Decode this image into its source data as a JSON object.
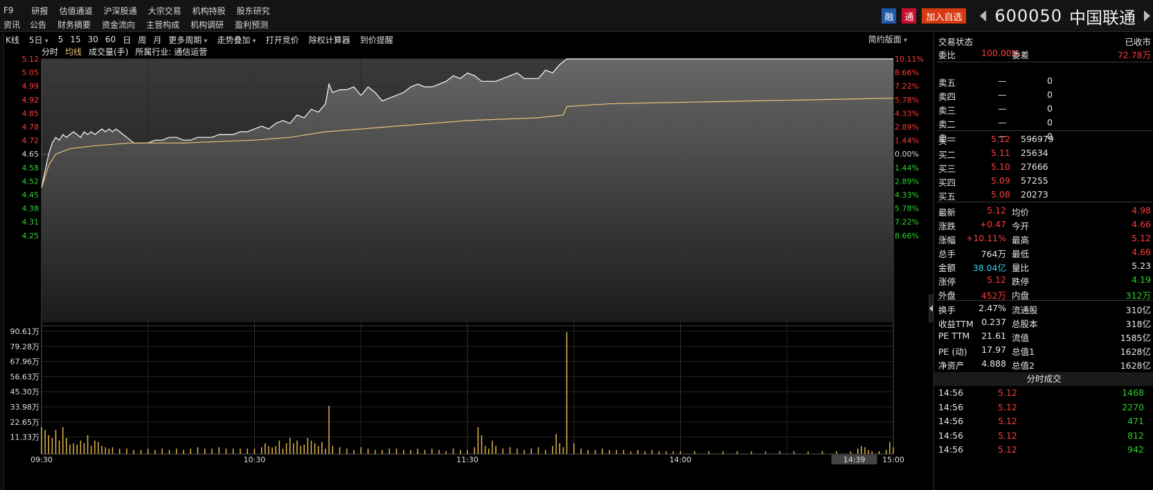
{
  "header": {
    "menu_row1": [
      "F9",
      "研报",
      "估值通道",
      "沪深股通",
      "大宗交易",
      "机构持股",
      "股东研究"
    ],
    "menu_row2": [
      "资讯",
      "公告",
      "财务摘要",
      "资金流向",
      "主营构成",
      "机构调研",
      "盈利预测"
    ],
    "badge_rong": "融",
    "badge_tong": "通",
    "add_watch": "加入自选",
    "stock_code": "600050",
    "stock_name": "中国联通"
  },
  "toolbar": {
    "items": [
      "K线",
      "5日",
      "5",
      "15",
      "30",
      "60",
      "日",
      "周",
      "月",
      "更多周期",
      "走势叠加",
      "打开竞价",
      "除权计算器",
      "到价提醒"
    ],
    "layout": "简约版面"
  },
  "subbar": {
    "fenshi": "分时",
    "junxian": "均线",
    "volume": "成交量(手)",
    "industry": "所属行业: 通信运营"
  },
  "colors": {
    "up": "#ff3b3b",
    "down": "#2bd42b",
    "price_line": "#ffffff",
    "avg_line": "#e8c27a",
    "volume_bar": "#e8b84a"
  },
  "chart_data": {
    "type": "line",
    "price_axis": [
      "5.12",
      "5.05",
      "4.99",
      "4.92",
      "4.85",
      "4.78",
      "4.72",
      "4.65",
      "4.58",
      "4.52",
      "4.45",
      "4.38",
      "4.31",
      "4.25"
    ],
    "pct_axis": [
      "10.11%",
      "8.66%",
      "7.22%",
      "5.78%",
      "4.33%",
      "2.89%",
      "1.44%",
      "0.00%",
      "1.44%",
      "2.89%",
      "4.33%",
      "5.78%",
      "7.22%",
      "8.66%"
    ],
    "volume_axis": [
      "90.61万",
      "79.28万",
      "67.96万",
      "56.63万",
      "45.30万",
      "33.98万",
      "22.65万",
      "11.33万"
    ],
    "time_axis": [
      "09:30",
      "10:30",
      "11:30",
      "14:00",
      "15:00"
    ],
    "cursor_time": "14:39",
    "prev_close": 4.65,
    "ylim": [
      4.18,
      5.12
    ],
    "volume_max": 90.61,
    "price_points": [
      [
        0,
        4.66
      ],
      [
        1,
        4.72
      ],
      [
        2,
        4.78
      ],
      [
        3,
        4.82
      ],
      [
        4,
        4.84
      ],
      [
        5,
        4.83
      ],
      [
        6,
        4.85
      ],
      [
        7,
        4.84
      ],
      [
        8,
        4.85
      ],
      [
        9,
        4.86
      ],
      [
        10,
        4.85
      ],
      [
        11,
        4.84
      ],
      [
        12,
        4.86
      ],
      [
        13,
        4.85
      ],
      [
        14,
        4.86
      ],
      [
        15,
        4.85
      ],
      [
        16,
        4.86
      ],
      [
        17,
        4.87
      ],
      [
        18,
        4.86
      ],
      [
        19,
        4.87
      ],
      [
        20,
        4.86
      ],
      [
        21,
        4.87
      ],
      [
        22,
        4.86
      ],
      [
        23,
        4.85
      ],
      [
        24,
        4.84
      ],
      [
        25,
        4.83
      ],
      [
        26,
        4.82
      ],
      [
        27,
        4.82
      ],
      [
        28,
        4.82
      ],
      [
        29,
        4.82
      ],
      [
        30,
        4.82
      ],
      [
        32,
        4.83
      ],
      [
        34,
        4.83
      ],
      [
        36,
        4.84
      ],
      [
        38,
        4.84
      ],
      [
        40,
        4.83
      ],
      [
        42,
        4.83
      ],
      [
        44,
        4.84
      ],
      [
        46,
        4.84
      ],
      [
        48,
        4.84
      ],
      [
        50,
        4.85
      ],
      [
        52,
        4.85
      ],
      [
        54,
        4.85
      ],
      [
        56,
        4.86
      ],
      [
        58,
        4.86
      ],
      [
        60,
        4.87
      ],
      [
        62,
        4.88
      ],
      [
        64,
        4.87
      ],
      [
        66,
        4.89
      ],
      [
        68,
        4.9
      ],
      [
        70,
        4.89
      ],
      [
        72,
        4.92
      ],
      [
        74,
        4.91
      ],
      [
        76,
        4.94
      ],
      [
        78,
        4.93
      ],
      [
        80,
        4.96
      ],
      [
        81,
        5.03
      ],
      [
        82,
        5.0
      ],
      [
        84,
        5.01
      ],
      [
        86,
        5.01
      ],
      [
        88,
        5.02
      ],
      [
        90,
        4.99
      ],
      [
        92,
        5.02
      ],
      [
        94,
        5.0
      ],
      [
        96,
        4.97
      ],
      [
        98,
        4.98
      ],
      [
        100,
        4.99
      ],
      [
        102,
        5.0
      ],
      [
        104,
        5.02
      ],
      [
        106,
        5.03
      ],
      [
        108,
        5.02
      ],
      [
        110,
        5.02
      ],
      [
        112,
        5.03
      ],
      [
        114,
        5.04
      ],
      [
        116,
        5.06
      ],
      [
        118,
        5.05
      ],
      [
        120,
        5.07
      ],
      [
        122,
        5.06
      ],
      [
        124,
        5.04
      ],
      [
        126,
        5.04
      ],
      [
        128,
        5.04
      ],
      [
        130,
        5.05
      ],
      [
        132,
        5.06
      ],
      [
        134,
        5.07
      ],
      [
        136,
        5.05
      ],
      [
        138,
        5.05
      ],
      [
        140,
        5.05
      ],
      [
        142,
        5.08
      ],
      [
        144,
        5.07
      ],
      [
        146,
        5.1
      ],
      [
        148,
        5.12
      ],
      [
        150,
        5.12
      ],
      [
        240,
        5.12
      ]
    ],
    "avg_points": [
      [
        0,
        4.66
      ],
      [
        2,
        4.74
      ],
      [
        4,
        4.78
      ],
      [
        8,
        4.8
      ],
      [
        15,
        4.81
      ],
      [
        25,
        4.82
      ],
      [
        40,
        4.82
      ],
      [
        60,
        4.83
      ],
      [
        70,
        4.84
      ],
      [
        80,
        4.86
      ],
      [
        90,
        4.87
      ],
      [
        100,
        4.88
      ],
      [
        110,
        4.89
      ],
      [
        120,
        4.9
      ],
      [
        140,
        4.91
      ],
      [
        147,
        4.92
      ],
      [
        148,
        4.95
      ],
      [
        160,
        4.96
      ],
      [
        200,
        4.97
      ],
      [
        240,
        4.98
      ]
    ],
    "volume_bars": [
      [
        0,
        20
      ],
      [
        1,
        18
      ],
      [
        2,
        14
      ],
      [
        3,
        12
      ],
      [
        4,
        18
      ],
      [
        5,
        10
      ],
      [
        6,
        20
      ],
      [
        7,
        12
      ],
      [
        8,
        7
      ],
      [
        9,
        8
      ],
      [
        10,
        7
      ],
      [
        11,
        10
      ],
      [
        12,
        8
      ],
      [
        13,
        14
      ],
      [
        14,
        6
      ],
      [
        15,
        10
      ],
      [
        16,
        9
      ],
      [
        17,
        6
      ],
      [
        18,
        5
      ],
      [
        19,
        4
      ],
      [
        20,
        5
      ],
      [
        22,
        4
      ],
      [
        24,
        4
      ],
      [
        26,
        3
      ],
      [
        28,
        3
      ],
      [
        30,
        4
      ],
      [
        32,
        3
      ],
      [
        34,
        4
      ],
      [
        36,
        3
      ],
      [
        38,
        4
      ],
      [
        40,
        3
      ],
      [
        42,
        4
      ],
      [
        44,
        5
      ],
      [
        46,
        4
      ],
      [
        48,
        4
      ],
      [
        50,
        5
      ],
      [
        52,
        4
      ],
      [
        54,
        4
      ],
      [
        56,
        4
      ],
      [
        58,
        4
      ],
      [
        60,
        4
      ],
      [
        62,
        5
      ],
      [
        63,
        8
      ],
      [
        64,
        6
      ],
      [
        65,
        5
      ],
      [
        66,
        6
      ],
      [
        67,
        10
      ],
      [
        68,
        4
      ],
      [
        69,
        8
      ],
      [
        70,
        12
      ],
      [
        71,
        8
      ],
      [
        72,
        10
      ],
      [
        73,
        6
      ],
      [
        74,
        7
      ],
      [
        75,
        12
      ],
      [
        76,
        10
      ],
      [
        77,
        8
      ],
      [
        78,
        6
      ],
      [
        79,
        9
      ],
      [
        80,
        4
      ],
      [
        81,
        36
      ],
      [
        82,
        6
      ],
      [
        84,
        5
      ],
      [
        86,
        4
      ],
      [
        88,
        3
      ],
      [
        90,
        5
      ],
      [
        92,
        4
      ],
      [
        94,
        3
      ],
      [
        96,
        3
      ],
      [
        98,
        4
      ],
      [
        100,
        4
      ],
      [
        102,
        3
      ],
      [
        104,
        3
      ],
      [
        106,
        4
      ],
      [
        108,
        3
      ],
      [
        110,
        4
      ],
      [
        112,
        3
      ],
      [
        114,
        2
      ],
      [
        116,
        4
      ],
      [
        118,
        3
      ],
      [
        120,
        3
      ],
      [
        122,
        5
      ],
      [
        123,
        20
      ],
      [
        124,
        14
      ],
      [
        125,
        6
      ],
      [
        126,
        4
      ],
      [
        127,
        10
      ],
      [
        128,
        6
      ],
      [
        130,
        4
      ],
      [
        132,
        5
      ],
      [
        134,
        4
      ],
      [
        136,
        3
      ],
      [
        138,
        4
      ],
      [
        140,
        5
      ],
      [
        142,
        3
      ],
      [
        144,
        6
      ],
      [
        145,
        15
      ],
      [
        146,
        8
      ],
      [
        147,
        5
      ],
      [
        148,
        91
      ],
      [
        150,
        8
      ],
      [
        152,
        4
      ],
      [
        154,
        3
      ],
      [
        156,
        3
      ],
      [
        158,
        4
      ],
      [
        160,
        3
      ],
      [
        162,
        3
      ],
      [
        164,
        3
      ],
      [
        166,
        2
      ],
      [
        168,
        3
      ],
      [
        170,
        2
      ],
      [
        172,
        3
      ],
      [
        174,
        2
      ],
      [
        176,
        2
      ],
      [
        178,
        2
      ],
      [
        180,
        2
      ],
      [
        184,
        2
      ],
      [
        188,
        2
      ],
      [
        192,
        2
      ],
      [
        196,
        2
      ],
      [
        200,
        2
      ],
      [
        204,
        2
      ],
      [
        208,
        2
      ],
      [
        212,
        2
      ],
      [
        216,
        2
      ],
      [
        220,
        2
      ],
      [
        224,
        2
      ],
      [
        228,
        2
      ],
      [
        230,
        4
      ],
      [
        231,
        6
      ],
      [
        232,
        5
      ],
      [
        233,
        3
      ],
      [
        234,
        2
      ],
      [
        236,
        2
      ],
      [
        238,
        3
      ],
      [
        239,
        9
      ],
      [
        240,
        5
      ]
    ]
  },
  "panel": {
    "trade_status_label": "交易状态",
    "trade_status": "已收市",
    "weibi_label": "委比",
    "weibi": "100.00%",
    "weicha_label": "委差",
    "weicha": "72.78万",
    "sell": [
      {
        "label": "卖五",
        "price": "—",
        "vol": "0"
      },
      {
        "label": "卖四",
        "price": "—",
        "vol": "0"
      },
      {
        "label": "卖三",
        "price": "—",
        "vol": "0"
      },
      {
        "label": "卖二",
        "price": "—",
        "vol": "0"
      },
      {
        "label": "卖一",
        "price": "—",
        "vol": "0"
      }
    ],
    "buy": [
      {
        "label": "买一",
        "price": "5.12",
        "vol": "596979"
      },
      {
        "label": "买二",
        "price": "5.11",
        "vol": "25634"
      },
      {
        "label": "买三",
        "price": "5.10",
        "vol": "27666"
      },
      {
        "label": "买四",
        "price": "5.09",
        "vol": "57255"
      },
      {
        "label": "买五",
        "price": "5.08",
        "vol": "20273"
      }
    ],
    "stats": [
      {
        "l1": "最新",
        "v1": "5.12",
        "c1": "red",
        "l2": "均价",
        "v2": "4.98",
        "c2": "red"
      },
      {
        "l1": "涨跌",
        "v1": "+0.47",
        "c1": "red",
        "l2": "今开",
        "v2": "4.66",
        "c2": "red"
      },
      {
        "l1": "涨幅",
        "v1": "+10.11%",
        "c1": "red",
        "l2": "最高",
        "v2": "5.12",
        "c2": "red"
      },
      {
        "l1": "总手",
        "v1": "764万",
        "c1": "white",
        "l2": "最低",
        "v2": "4.66",
        "c2": "red"
      },
      {
        "l1": "金额",
        "v1": "38.04亿",
        "c1": "cyan",
        "l2": "量比",
        "v2": "5.23",
        "c2": "white"
      },
      {
        "l1": "涨停",
        "v1": "5.12",
        "c1": "red",
        "l2": "跌停",
        "v2": "4.19",
        "c2": "green"
      },
      {
        "l1": "外盘",
        "v1": "452万",
        "c1": "red",
        "l2": "内盘",
        "v2": "312万",
        "c2": "green"
      }
    ],
    "fund": [
      {
        "l1": "换手",
        "v1": "2.47%",
        "l2": "流通股",
        "v2": "310亿"
      },
      {
        "l1": "收益TTM",
        "v1": "0.237",
        "l2": "总股本",
        "v2": "318亿"
      },
      {
        "l1": "PE TTM",
        "v1": "21.61",
        "l2": "流值",
        "v2": "1585亿"
      },
      {
        "l1": "PE (动)",
        "v1": "17.97",
        "l2": "总值1",
        "v2": "1628亿"
      },
      {
        "l1": "净资产",
        "v1": "4.888",
        "l2": "总值2",
        "v2": "1628亿"
      }
    ],
    "ticks_title": "分时成交",
    "ticks": [
      {
        "time": "14:56",
        "price": "5.12",
        "vol": "1468"
      },
      {
        "time": "14:56",
        "price": "5.12",
        "vol": "2270"
      },
      {
        "time": "14:56",
        "price": "5.12",
        "vol": "471"
      },
      {
        "time": "14:56",
        "price": "5.12",
        "vol": "812"
      },
      {
        "time": "14:56",
        "price": "5.12",
        "vol": "942"
      }
    ]
  }
}
